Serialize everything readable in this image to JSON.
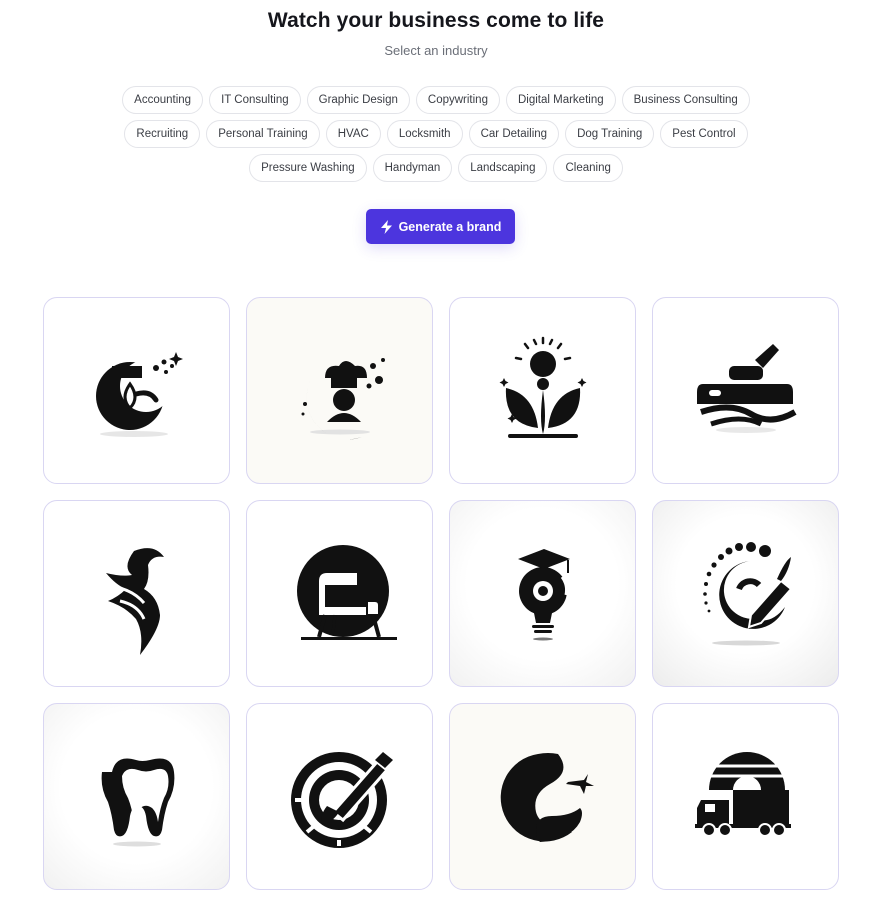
{
  "header": {
    "title": "Watch your business come to life",
    "subtitle": "Select an industry"
  },
  "industries": [
    [
      "Accounting",
      "IT Consulting",
      "Graphic Design",
      "Copywriting",
      "Digital Marketing",
      "Business Consulting"
    ],
    [
      "Recruiting",
      "Personal Training",
      "HVAC",
      "Locksmith",
      "Car Detailing",
      "Dog Training",
      "Pest Control"
    ],
    [
      "Pressure Washing",
      "Handyman",
      "Landscaping",
      "Cleaning"
    ]
  ],
  "cta": {
    "label": "Generate a brand",
    "icon": "lightning-icon",
    "color": "#4c35de"
  },
  "logos": [
    "cleaning-spray-logo",
    "chef-moon-logo",
    "yoga-lotus-logo",
    "car-wash-logo",
    "woman-silhouette-logo",
    "chair-furniture-logo",
    "graduate-lightbulb-logo",
    "pencil-swirl-logo",
    "tooth-logo",
    "paintbrush-circle-logo",
    "airplane-swoosh-logo",
    "delivery-truck-logo"
  ]
}
